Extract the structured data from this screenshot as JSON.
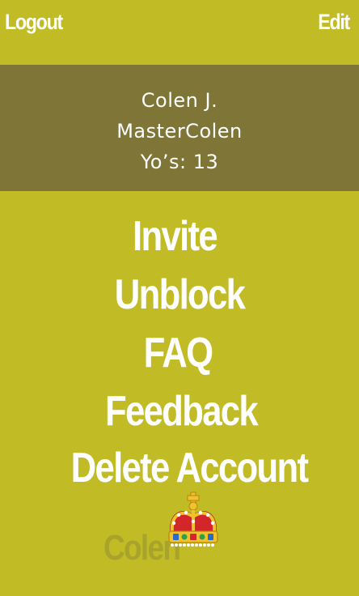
{
  "header": {
    "logout_label": "Logout",
    "edit_label": "Edit"
  },
  "profile": {
    "name": "Colen J.",
    "username": "MasterColen",
    "yos": "Yo’s: 13"
  },
  "menu": {
    "invite": "Invite",
    "unblock": "Unblock",
    "faq": "FAQ",
    "feedback": "Feedback",
    "delete_account": "Delete Account"
  },
  "logo": {
    "wordmark": "Colen",
    "icon": "crown-icon"
  },
  "colors": {
    "background": "#c1bb26",
    "profile_band": "#7e7536",
    "text": "#ffffff",
    "wordmark": "#a8a32a"
  }
}
